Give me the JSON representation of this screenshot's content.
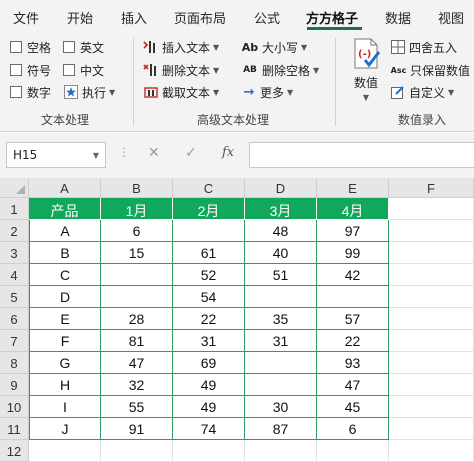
{
  "tabs": [
    {
      "label": "文件"
    },
    {
      "label": "开始"
    },
    {
      "label": "插入"
    },
    {
      "label": "页面布局"
    },
    {
      "label": "公式"
    },
    {
      "label": "方方格子"
    },
    {
      "label": "数据"
    },
    {
      "label": "视图"
    }
  ],
  "active_tab": "方方格子",
  "accent_color": "#1e7145",
  "ribbon": {
    "text_group": {
      "label": "文本处理",
      "space": "空格",
      "english": "英文",
      "symbol": "符号",
      "chinese": "中文",
      "digit": "数字",
      "execute": "执行"
    },
    "advanced_group": {
      "label": "高级文本处理",
      "insert_text": "插入文本",
      "delete_text": "删除文本",
      "extract_text": "截取文本",
      "case": "大小写",
      "delete_spaces": "删除空格",
      "more": "更多",
      "case_icon": "Ab",
      "spaces_icon": "AB"
    },
    "number_group": {
      "label": "数值录入",
      "value": "数值",
      "round": "四舍五入",
      "keep_value": "只保留数值",
      "custom": "自定义",
      "asc_icon": "Asc"
    }
  },
  "formula_bar": {
    "name_box": "H15",
    "fx": "fx",
    "cancel": "✕",
    "confirm": "✓",
    "dots": "⋮",
    "formula": ""
  },
  "sheet": {
    "columns": [
      "A",
      "B",
      "C",
      "D",
      "E",
      "F"
    ],
    "rows": [
      "1",
      "2",
      "3",
      "4",
      "5",
      "6",
      "7",
      "8",
      "9",
      "10",
      "11",
      "12"
    ],
    "table_header_color": "#12a85c",
    "table_border_color": "#2d9d5f",
    "header": [
      "产品",
      "1月",
      "2月",
      "3月",
      "4月"
    ],
    "data": [
      [
        "A",
        "6",
        "",
        "48",
        "97"
      ],
      [
        "B",
        "15",
        "61",
        "40",
        "99"
      ],
      [
        "C",
        "",
        "52",
        "51",
        "42"
      ],
      [
        "D",
        "",
        "54",
        "",
        ""
      ],
      [
        "E",
        "28",
        "22",
        "35",
        "57"
      ],
      [
        "F",
        "81",
        "31",
        "31",
        "22"
      ],
      [
        "G",
        "47",
        "69",
        "",
        "93"
      ],
      [
        "H",
        "32",
        "49",
        "",
        "47"
      ],
      [
        "I",
        "55",
        "49",
        "30",
        "45"
      ],
      [
        "J",
        "91",
        "74",
        "87",
        "6"
      ]
    ]
  }
}
